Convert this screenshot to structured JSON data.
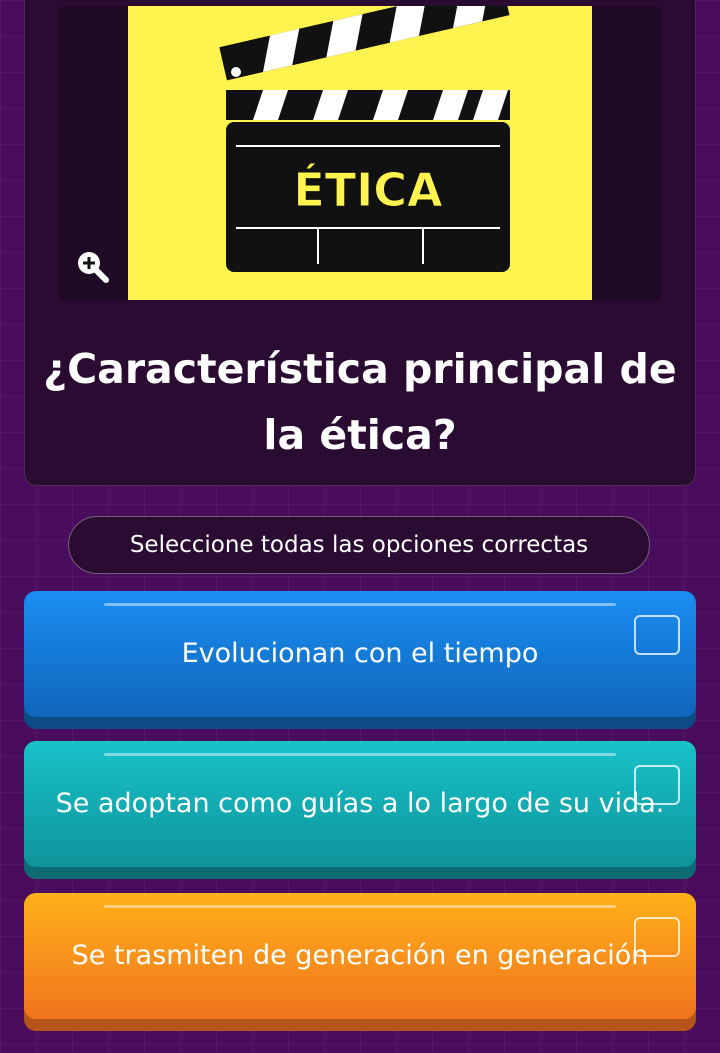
{
  "question": {
    "image_text": "ÉTICA",
    "text": "¿Característica principal de la ética?"
  },
  "instruction": "Seleccione todas las opciones correctas",
  "options": [
    {
      "label": "Evolucionan con el tiempo",
      "color": "#1a8ef2"
    },
    {
      "label": "Se adoptan como guías a lo largo de su vida.",
      "color": "#18c3c9"
    },
    {
      "label": "Se trasmiten de generación en generación",
      "color": "#ffb11a"
    }
  ],
  "colors": {
    "background": "#4a0d5e",
    "card": "#2a0b31",
    "image_background": "#fff44f"
  },
  "icons": {
    "zoom": "zoom-in-icon",
    "checkbox": "checkbox-icon"
  }
}
